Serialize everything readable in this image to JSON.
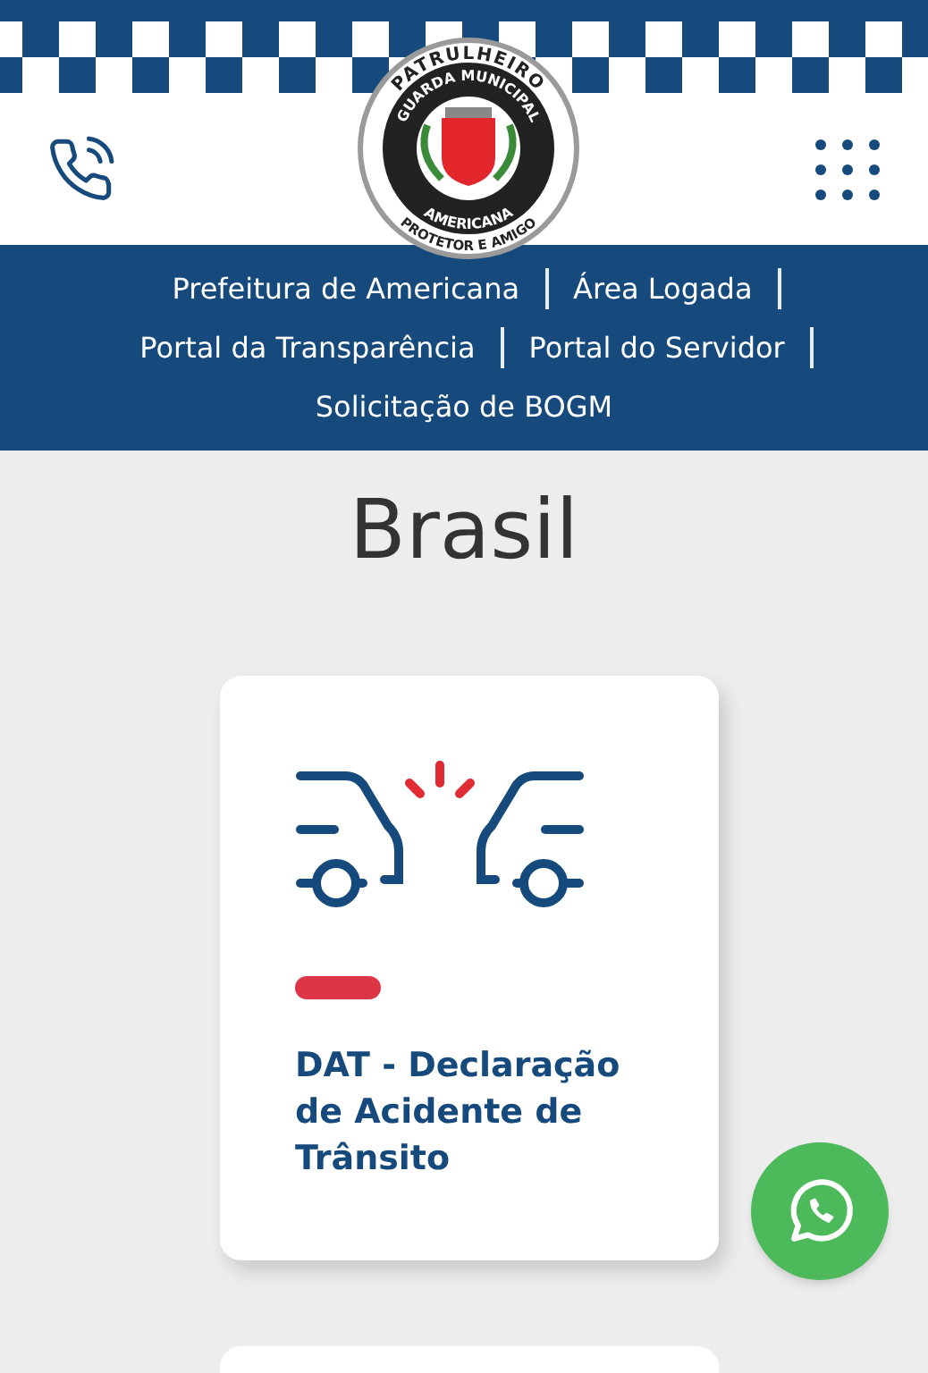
{
  "header": {
    "logo": {
      "top_text": "PATRULHEIRO",
      "inner_text": "GUARDA MUNICIPAL",
      "bottom_text": "AMERICANA",
      "motto": "PROTETOR E AMIGO"
    }
  },
  "nav": {
    "links": [
      "Prefeitura de Americana",
      "Área Logada",
      "Portal da Transparência",
      "Portal do Servidor",
      "Solicitação de BOGM"
    ]
  },
  "heading": "Brasil",
  "cards": [
    {
      "title": "DAT - Declaração de Acidente de Trânsito"
    }
  ]
}
